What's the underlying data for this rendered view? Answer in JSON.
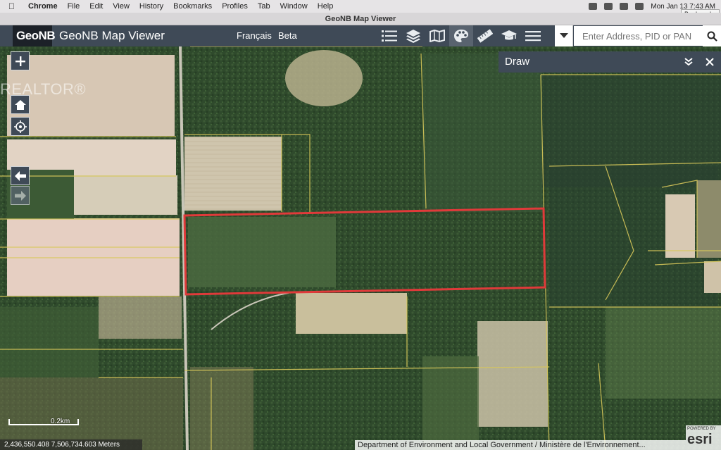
{
  "os_menubar": {
    "app": "Chrome",
    "items": [
      "File",
      "Edit",
      "View",
      "History",
      "Bookmarks",
      "Profiles",
      "Tab",
      "Window",
      "Help"
    ],
    "clock": "Mon Jan 13  7:43 AM",
    "bookmarks_tooltip": "Bookmarks"
  },
  "window": {
    "title": "GeoNB Map Viewer"
  },
  "header": {
    "logo": "GeoNB",
    "title": "GeoNB Map Viewer",
    "language": "Français",
    "beta": "Beta",
    "toolbar_icons": [
      "list-icon",
      "layers-icon",
      "basemap-icon",
      "palette-icon",
      "ruler-icon",
      "print-icon",
      "menu-icon"
    ],
    "search": {
      "placeholder": "Enter Address, PID or PAN",
      "value": ""
    }
  },
  "map": {
    "watermark": "REALTOR®",
    "controls": [
      "zoom-in-icon",
      "home-icon",
      "locate-icon",
      "back-icon",
      "forward-icon"
    ],
    "draw_panel": {
      "title": "Draw"
    },
    "scale_label": "0.2km",
    "coordinates": "2,436,550.408 7,506,734.603 Meters",
    "attribution": "Department of Environment and Local Government / Ministère de l'Environnement...",
    "esri_powered": "POWERED BY",
    "esri_logo": "esri",
    "colors": {
      "parcel_lines": "#d8c85a",
      "highlight_parcel": "#e03a3a"
    }
  }
}
